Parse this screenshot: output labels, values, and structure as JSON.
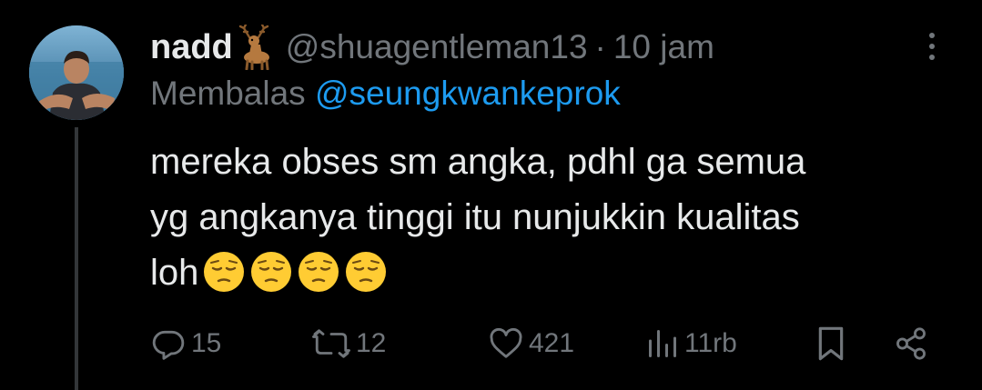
{
  "tweet": {
    "display_name": "nadd",
    "name_emoji": "deer-emoji",
    "handle": "@shuagentleman13",
    "separator": "·",
    "time": "10 jam",
    "reply_prefix": "Membalas",
    "reply_to": "@seungkwankeprok",
    "text_lines": [
      "mereka obses sm angka, pdhl ga semua",
      "yg angkanya tinggi itu nunjukkin kualitas",
      "loh"
    ],
    "text_emojis": [
      "pensive-face-emoji",
      "pensive-face-emoji",
      "pensive-face-emoji",
      "pensive-face-emoji"
    ]
  },
  "actions": {
    "replies": "15",
    "reposts": "12",
    "likes": "421",
    "views": "11rb"
  },
  "colors": {
    "background": "#000000",
    "text": "#e7e9ea",
    "secondary": "#71767b",
    "accent": "#1d9bf0",
    "thread_line": "#333639"
  },
  "icons": {
    "reply": "reply-icon",
    "repost": "repost-icon",
    "like": "heart-icon",
    "views": "views-icon",
    "bookmark": "bookmark-icon",
    "share": "share-icon",
    "more": "more-icon"
  }
}
